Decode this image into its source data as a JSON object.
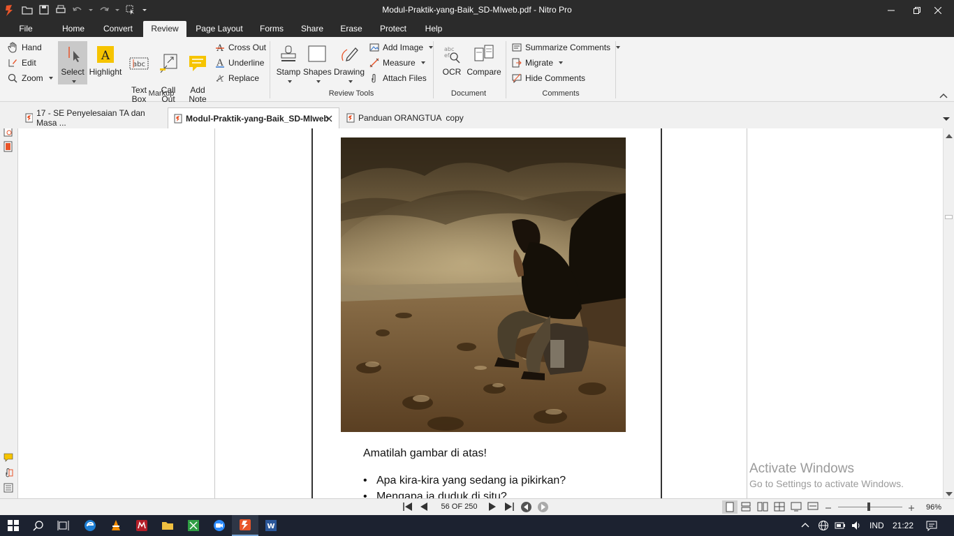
{
  "window": {
    "title": "Modul-Praktik-yang-Baik_SD-MIweb.pdf - Nitro Pro"
  },
  "menu": {
    "tabs": [
      {
        "label": "File"
      },
      {
        "label": "Home"
      },
      {
        "label": "Convert"
      },
      {
        "label": "Review"
      },
      {
        "label": "Page Layout"
      },
      {
        "label": "Forms"
      },
      {
        "label": "Share"
      },
      {
        "label": "Erase"
      },
      {
        "label": "Protect"
      },
      {
        "label": "Help"
      }
    ],
    "active": "Review"
  },
  "ribbon": {
    "left_tools": {
      "hand": "Hand",
      "edit": "Edit",
      "zoom": "Zoom"
    },
    "markup": {
      "group_label": "Markup",
      "select": "Select",
      "highlight": "Highlight",
      "text_box": "Text\nBox",
      "call_out": "Call\nOut",
      "add_note": "Add\nNote",
      "cross_out": "Cross Out",
      "underline": "Underline",
      "replace": "Replace"
    },
    "review_tools": {
      "group_label": "Review Tools",
      "stamp": "Stamp",
      "shapes": "Shapes",
      "drawing": "Drawing",
      "add_image": "Add Image",
      "measure": "Measure",
      "attach_files": "Attach Files"
    },
    "document": {
      "group_label": "Document",
      "ocr": "OCR",
      "compare": "Compare"
    },
    "comments": {
      "group_label": "Comments",
      "summarize": "Summarize Comments",
      "migrate": "Migrate",
      "hide": "Hide Comments"
    }
  },
  "doc_tabs": [
    {
      "label": "17 - SE Penyelesaian TA dan Masa ...",
      "active": false
    },
    {
      "label": "Modul-Praktik-yang-Baik_SD-MIweb",
      "active": true
    },
    {
      "label": "Panduan ORANGTUA  copy",
      "active": false
    }
  ],
  "document": {
    "instruction": "Amatilah gambar di atas!",
    "bullets": [
      "Apa kira-kira yang sedang ia pikirkan?",
      "Mengapa ia duduk di situ?"
    ]
  },
  "watermark": {
    "line1": "Activate Windows",
    "line2": "Go to Settings to activate Windows."
  },
  "status": {
    "page_info": "56 OF 250",
    "zoom": "96%"
  },
  "taskbar": {
    "language": "IND",
    "time": "21:22"
  }
}
